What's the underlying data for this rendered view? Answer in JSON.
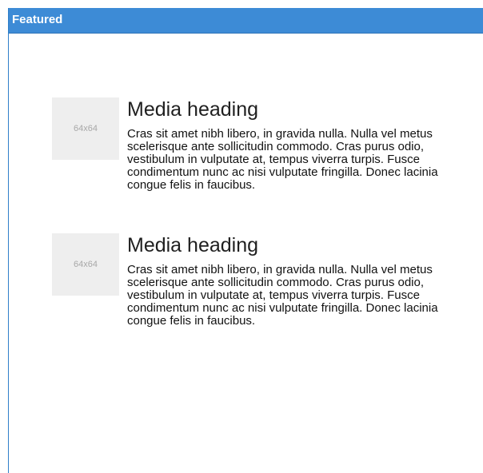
{
  "panel": {
    "title": "Featured",
    "header_color": "#3d8bd6"
  },
  "media_items": [
    {
      "thumbnail_label": "64x64",
      "heading": "Media heading",
      "text": "Cras sit amet nibh libero, in gravida nulla. Nulla vel metus scelerisque ante sollicitudin commodo. Cras purus odio, vestibulum in vulputate at, tempus viverra turpis. Fusce condimentum nunc ac nisi vulputate fringilla. Donec lacinia congue felis in faucibus."
    },
    {
      "thumbnail_label": "64x64",
      "heading": "Media heading",
      "text": "Cras sit amet nibh libero, in gravida nulla. Nulla vel metus scelerisque ante sollicitudin commodo. Cras purus odio, vestibulum in vulputate at, tempus viverra turpis. Fusce condimentum nunc ac nisi vulputate fringilla. Donec lacinia congue felis in faucibus."
    }
  ]
}
